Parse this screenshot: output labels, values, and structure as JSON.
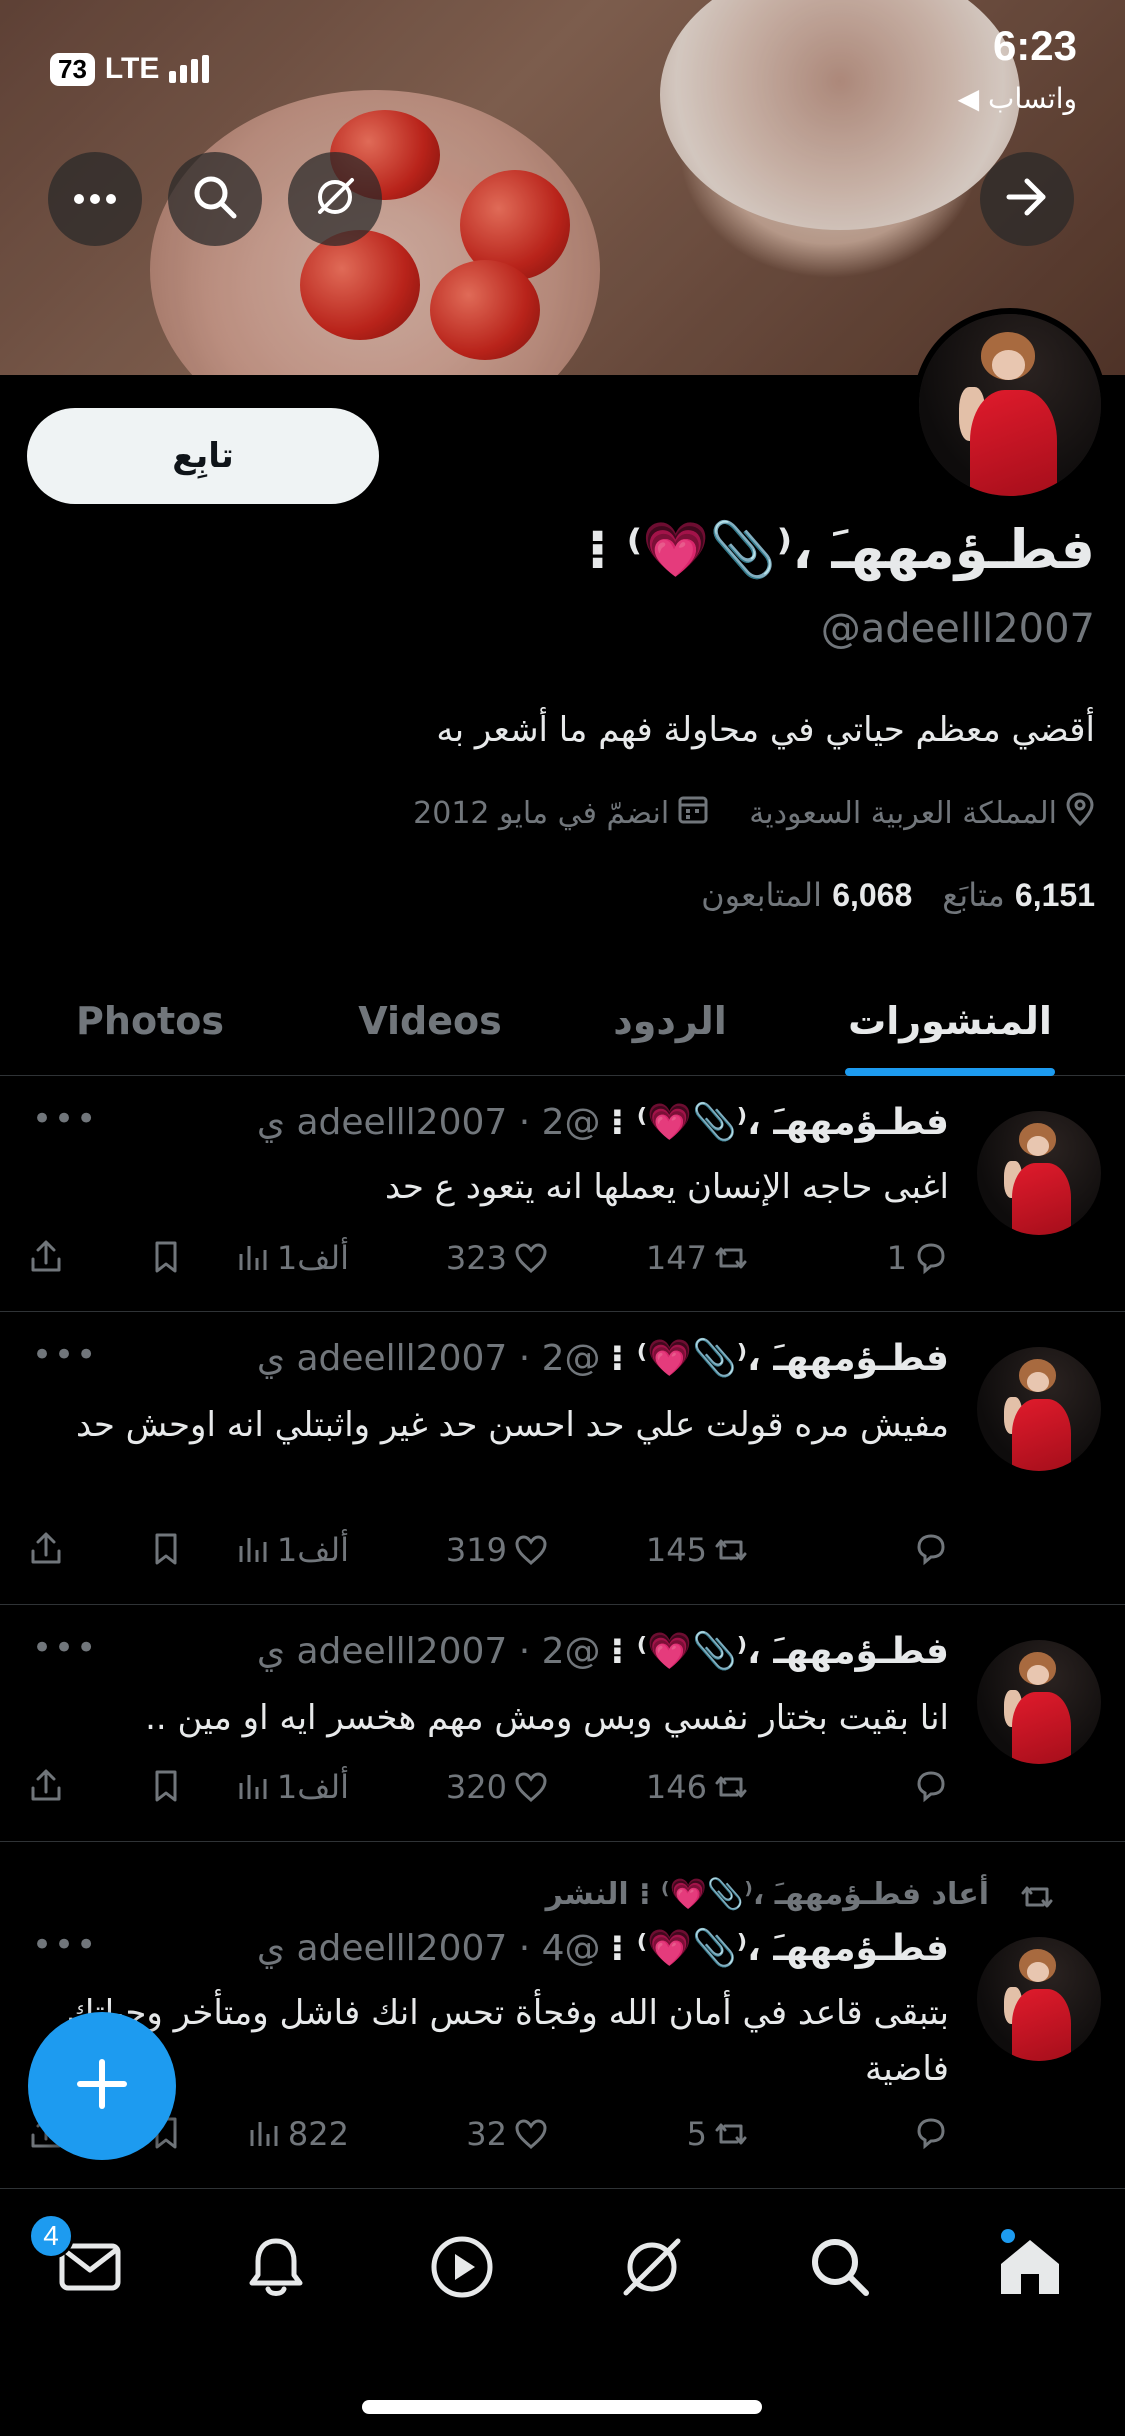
{
  "status_bar": {
    "time": "6:23",
    "back_app": "◀ واتساب",
    "battery": "73",
    "network": "LTE"
  },
  "header": {
    "back_icon": "arrow-right-icon",
    "more_icon": "ellipsis-icon",
    "search_icon": "search-icon",
    "grok_icon": "grok-icon"
  },
  "profile": {
    "follow_label": "تابِع",
    "name": "فطـؤمههـَ ،⁽📎💗⁾ ⁝",
    "handle": "@adeelll2007",
    "bio": "أقضي معظم حياتي في محاولة فهم ما أشعر به",
    "location": "المملكة العربية السعودية",
    "joined": "انضمّ في مايو 2012",
    "following_count": "6,151",
    "following_label": "متابَع",
    "followers_count": "6,068",
    "followers_label": "المتابعون"
  },
  "tabs": [
    {
      "label": "المنشورات",
      "active": true
    },
    {
      "label": "الردود",
      "active": false
    },
    {
      "label": "Videos",
      "active": false
    },
    {
      "label": "Photos",
      "active": false
    }
  ],
  "tweets": [
    {
      "name": "فطـؤمههـَ ،⁽📎💗⁾ ⁝",
      "meta": "@adeelll2007 · 2 ي",
      "text": "اغبى حاجه الإنسان يعملها انه يتعود ع حد",
      "replies": "1",
      "retweets": "147",
      "likes": "323",
      "views": "1ألف"
    },
    {
      "name": "فطـؤمههـَ ،⁽📎💗⁾ ⁝",
      "meta": "@adeelll2007 · 2 ي",
      "text": "مفيش مره قولت علي حد احسن حد غير واثبتلي انه اوحش حد",
      "replies": "",
      "retweets": "145",
      "likes": "319",
      "views": "1ألف"
    },
    {
      "name": "فطـؤمههـَ ،⁽📎💗⁾ ⁝",
      "meta": "@adeelll2007 · 2 ي",
      "text": "انا بقيت بختار نفسي وبس ومش مهم هخسر ايه او مين ..",
      "replies": "",
      "retweets": "146",
      "likes": "320",
      "views": "1ألف"
    },
    {
      "retweet_label": "أعاد فطـؤمههـَ ،⁽📎💗⁾ ⁝ النشر",
      "name": "فطـؤمههـَ ،⁽📎💗⁾ ⁝",
      "meta": "@adeelll2007 · 4 ي",
      "text": "بتبقى قاعد في أمان الله وفجأة تحس انك فاشل ومتأخر وحياتك فاضية",
      "replies": "",
      "retweets": "5",
      "likes": "32",
      "views": "822"
    }
  ],
  "bottom_nav": {
    "messages_badge": "4"
  },
  "colors": {
    "accent": "#1d9bf0",
    "background": "#000000",
    "muted": "#71767b"
  }
}
